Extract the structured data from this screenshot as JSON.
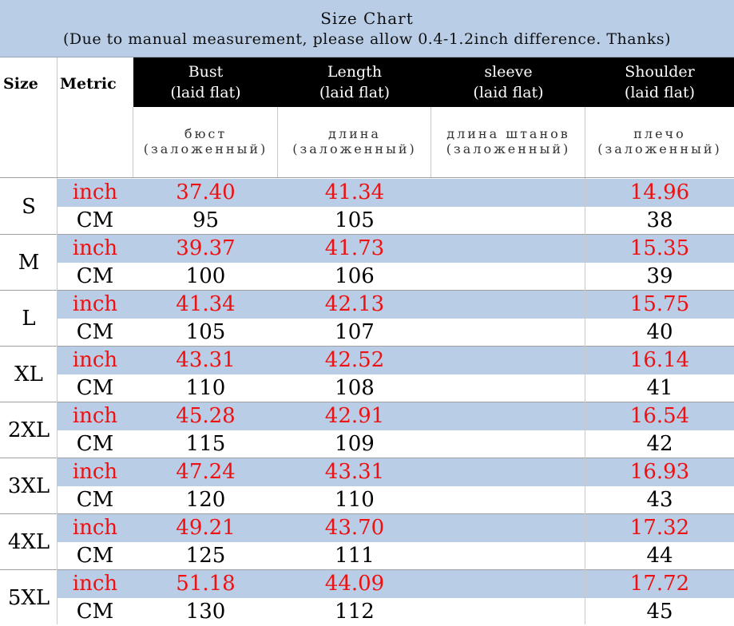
{
  "title": "Size Chart",
  "subtitle": "(Due to manual measurement, please allow 0.4-1.2inch difference. Thanks)",
  "header": {
    "size_label": "Size",
    "metric_label": "Metric",
    "columns": [
      {
        "name": "Bust",
        "sub": "(laid flat)",
        "ru_1": "бюст",
        "ru_2": "(заложенный)"
      },
      {
        "name": "Length",
        "sub": "(laid flat)",
        "ru_1": "длина",
        "ru_2": "(заложенный)"
      },
      {
        "name": "sleeve",
        "sub": "(laid flat)",
        "ru_1": "длина штанов",
        "ru_2": "(заложенный)"
      },
      {
        "name": "Shoulder",
        "sub": "(laid flat)",
        "ru_1": "плечо",
        "ru_2": "(заложенный)"
      }
    ]
  },
  "rows": [
    {
      "size": "S",
      "inch": {
        "metric": "inch",
        "bust": "37.40",
        "length": "41.34",
        "sleeve": "",
        "shoulder": "14.96"
      },
      "cm": {
        "metric": "CM",
        "bust": "95",
        "length": "105",
        "sleeve": "",
        "shoulder": "38"
      }
    },
    {
      "size": "M",
      "inch": {
        "metric": "inch",
        "bust": "39.37",
        "length": "41.73",
        "sleeve": "",
        "shoulder": "15.35"
      },
      "cm": {
        "metric": "CM",
        "bust": "100",
        "length": "106",
        "sleeve": "",
        "shoulder": "39"
      }
    },
    {
      "size": "L",
      "inch": {
        "metric": "inch",
        "bust": "41.34",
        "length": "42.13",
        "sleeve": "",
        "shoulder": "15.75"
      },
      "cm": {
        "metric": "CM",
        "bust": "105",
        "length": "107",
        "sleeve": "",
        "shoulder": "40"
      }
    },
    {
      "size": "XL",
      "inch": {
        "metric": "inch",
        "bust": "43.31",
        "length": "42.52",
        "sleeve": "",
        "shoulder": "16.14"
      },
      "cm": {
        "metric": "CM",
        "bust": "110",
        "length": "108",
        "sleeve": "",
        "shoulder": "41"
      }
    },
    {
      "size": "2XL",
      "inch": {
        "metric": "inch",
        "bust": "45.28",
        "length": "42.91",
        "sleeve": "",
        "shoulder": "16.54"
      },
      "cm": {
        "metric": "CM",
        "bust": "115",
        "length": "109",
        "sleeve": "",
        "shoulder": "42"
      }
    },
    {
      "size": "3XL",
      "inch": {
        "metric": "inch",
        "bust": "47.24",
        "length": "43.31",
        "sleeve": "",
        "shoulder": "16.93"
      },
      "cm": {
        "metric": "CM",
        "bust": "120",
        "length": "110",
        "sleeve": "",
        "shoulder": "43"
      }
    },
    {
      "size": "4XL",
      "inch": {
        "metric": "inch",
        "bust": "49.21",
        "length": "43.70",
        "sleeve": "",
        "shoulder": "17.32"
      },
      "cm": {
        "metric": "CM",
        "bust": "125",
        "length": "111",
        "sleeve": "",
        "shoulder": "44"
      }
    },
    {
      "size": "5XL",
      "inch": {
        "metric": "inch",
        "bust": "51.18",
        "length": "44.09",
        "sleeve": "",
        "shoulder": "17.72"
      },
      "cm": {
        "metric": "CM",
        "bust": "130",
        "length": "112",
        "sleeve": "",
        "shoulder": "45"
      }
    }
  ],
  "colors": {
    "band_blue": "#b9cde6",
    "inch_text": "#ee1111",
    "cm_text": "#000000",
    "header_bg": "#000000",
    "header_text": "#ffffff"
  }
}
